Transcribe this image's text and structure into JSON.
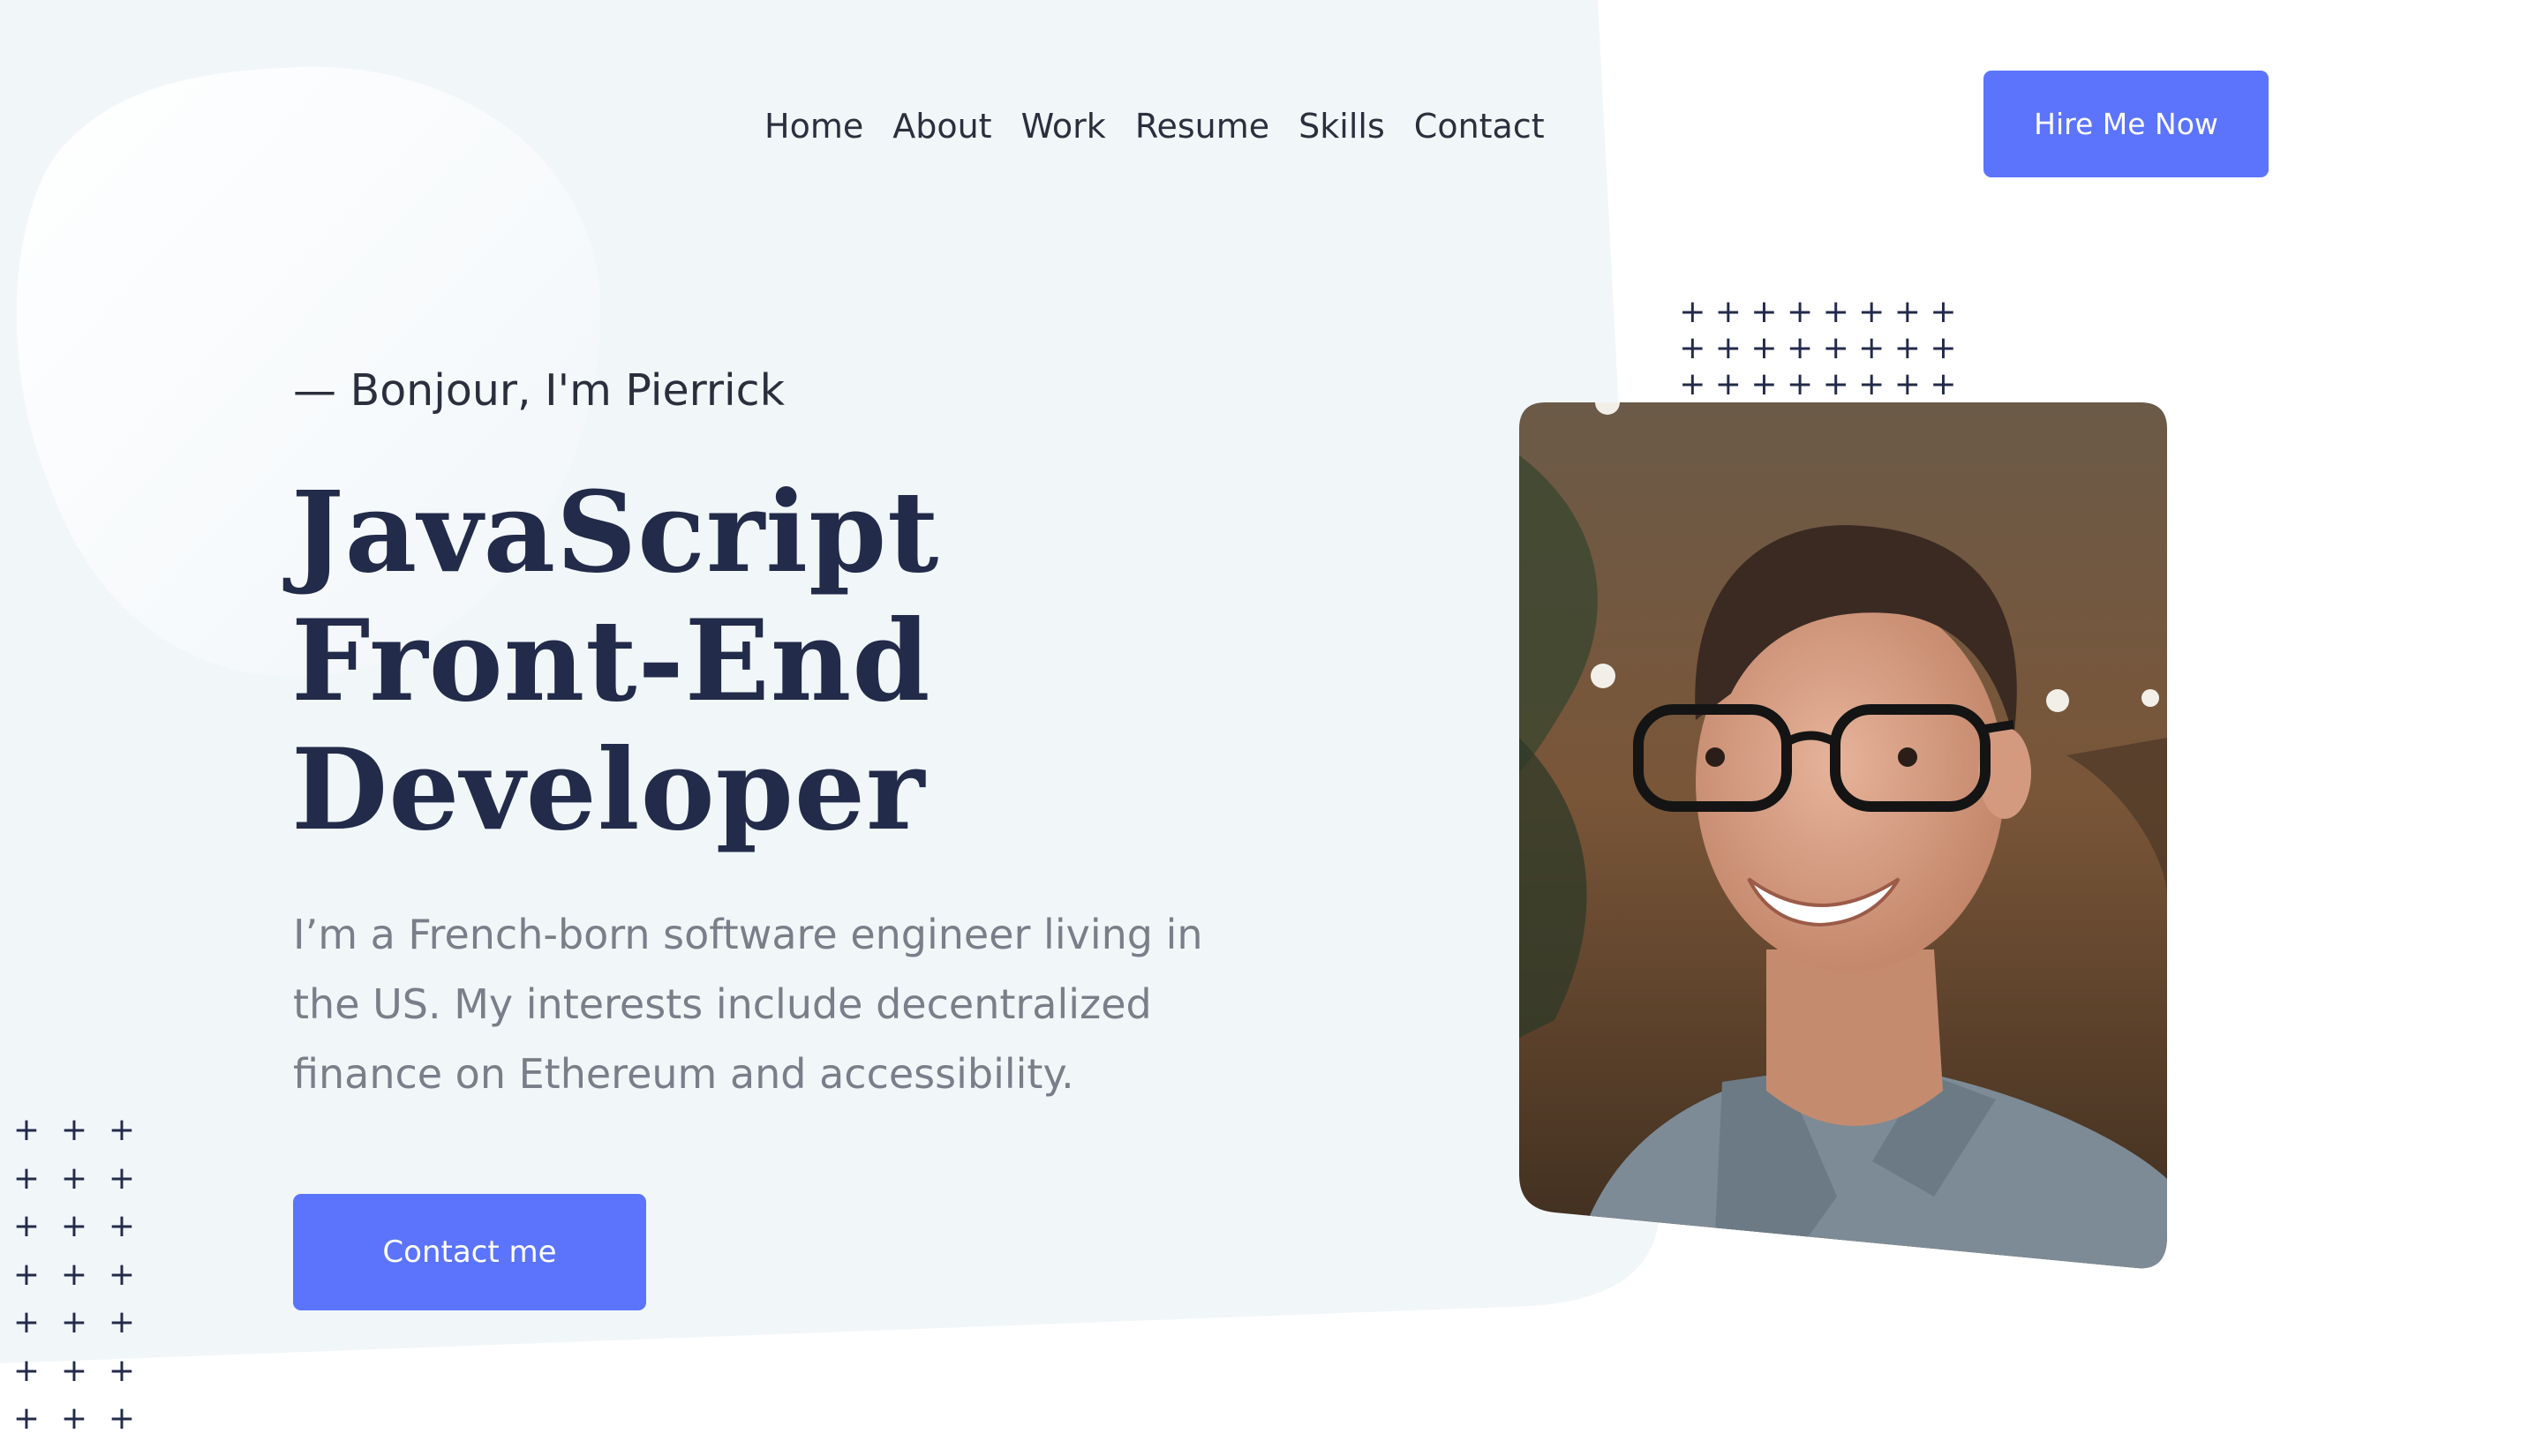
{
  "nav": {
    "items": [
      {
        "label": "Home"
      },
      {
        "label": "About"
      },
      {
        "label": "Work"
      },
      {
        "label": "Resume"
      },
      {
        "label": "Skills"
      },
      {
        "label": "Contact"
      }
    ],
    "cta_label": "Hire Me Now"
  },
  "hero": {
    "greeting": "— Bonjour, I'm Pierrick",
    "headline": [
      "JavaScript",
      "Front-End",
      "Developer"
    ],
    "bio": "I’m a French-born software engineer living in the US. My interests include decentralized finance on Ethereum and accessibility.",
    "cta_label": "Contact me"
  },
  "colors": {
    "accent": "#5b74fb",
    "heading": "#232b4a",
    "body_text": "#7b7e89",
    "hero_background": "#f1f6f9"
  },
  "icons": {
    "pattern_top": "plus-pattern",
    "pattern_left": "plus-pattern"
  }
}
